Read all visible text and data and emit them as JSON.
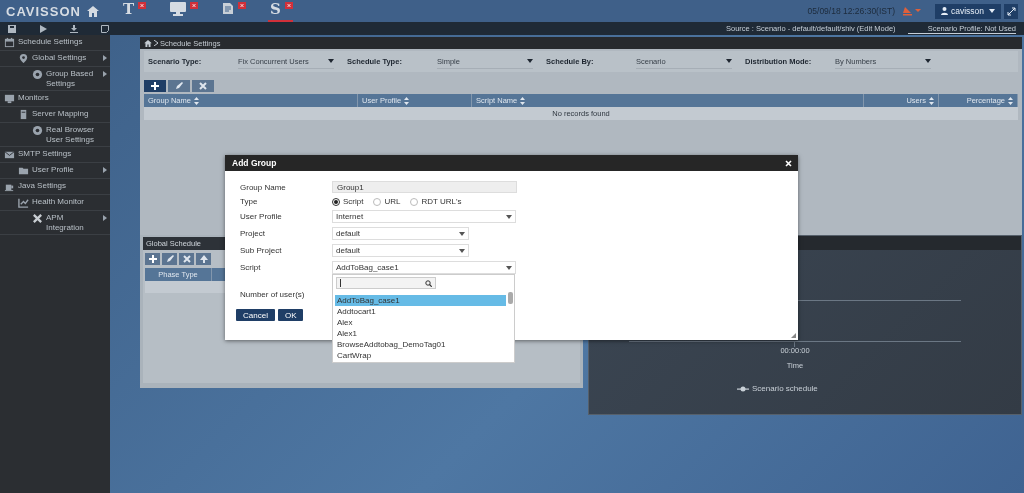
{
  "app": {
    "logo": "CAVISSON",
    "tabs": [
      {
        "kind": "glyph",
        "label": "T",
        "selected": false
      },
      {
        "kind": "monitor",
        "selected": false
      },
      {
        "kind": "document",
        "selected": false
      },
      {
        "kind": "glyph",
        "label": "S",
        "selected": true
      }
    ],
    "datetime": "05/09/18 12:26:30(IST)",
    "user": "cavisson"
  },
  "toolbar": {
    "source": "Source : Scenario - default/default/shiv (Edit Mode)",
    "profile": "Scenario Profile: Not Used"
  },
  "sidebar": {
    "items": [
      {
        "label": "Schedule Settings",
        "submenu": false,
        "children": [
          {
            "label": "Global Settings",
            "submenu": true,
            "children": [
              {
                "label": "Group Based Settings",
                "submenu": true
              }
            ]
          }
        ]
      },
      {
        "label": "Monitors",
        "submenu": false,
        "children": [
          {
            "label": "Server Mapping",
            "submenu": false,
            "children": [
              {
                "label": "Real Browser User Settings",
                "submenu": false
              }
            ]
          }
        ]
      },
      {
        "label": "SMTP Settings",
        "submenu": false,
        "children": [
          {
            "label": "User Profile",
            "submenu": true
          }
        ]
      },
      {
        "label": "Java Settings",
        "submenu": false,
        "children": [
          {
            "label": "Health Monitor",
            "submenu": false,
            "children": [
              {
                "label": "APM Integration",
                "submenu": true
              }
            ]
          }
        ]
      }
    ]
  },
  "breadcrumb": "Schedule Settings",
  "filters": [
    {
      "label": "Scenario Type:",
      "value": "Fix Concurrent Users"
    },
    {
      "label": "Schedule Type:",
      "value": "Simple"
    },
    {
      "label": "Schedule By:",
      "value": "Scenario"
    },
    {
      "label": "Distribution Mode:",
      "value": "By Numbers"
    }
  ],
  "group_table": {
    "columns": [
      "Group Name",
      "User Profile",
      "Script Name",
      "Users",
      "Percentage"
    ],
    "empty_message": "No records found"
  },
  "global_schedule": {
    "title": "Global Schedule",
    "columns": [
      "Phase Type"
    ]
  },
  "chart": {
    "x_tick": "00:00:00",
    "x_label": "Time",
    "legend": "Scenario schedule"
  },
  "dialog": {
    "title": "Add Group",
    "group_name": {
      "label": "Group Name",
      "value": "Group1"
    },
    "type": {
      "label": "Type",
      "options": [
        {
          "label": "Script",
          "selected": true
        },
        {
          "label": "URL",
          "selected": false
        },
        {
          "label": "RDT URL's",
          "selected": false
        }
      ]
    },
    "selects": [
      {
        "label": "User Profile",
        "value": "Internet",
        "wide": true
      },
      {
        "label": "Project",
        "value": "default",
        "wide": false
      },
      {
        "label": "Sub Project",
        "value": "default",
        "wide": false
      },
      {
        "label": "Script",
        "value": "AddToBag_case1",
        "wide": true,
        "expanded": true
      }
    ],
    "users_label": "Number of user(s)",
    "dropdown": {
      "options": [
        {
          "label": "AddToBag_case1",
          "selected": true
        },
        {
          "label": "Addtocart1",
          "selected": false
        },
        {
          "label": "Alex",
          "selected": false
        },
        {
          "label": "Alex1",
          "selected": false
        },
        {
          "label": "BrowseAddtobag_DemoTag01",
          "selected": false
        },
        {
          "label": "CartWrap",
          "selected": false
        }
      ]
    },
    "buttons": [
      "Cancel",
      "OK"
    ]
  }
}
